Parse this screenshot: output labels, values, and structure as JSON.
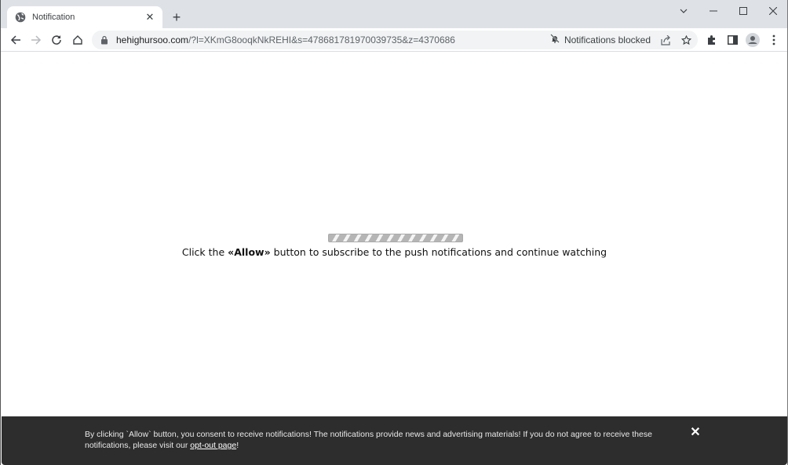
{
  "browser": {
    "tab": {
      "title": "Notification",
      "icon": "globe-icon",
      "close_icon": "close-icon"
    },
    "new_tab_icon": "plus-icon",
    "window_controls": [
      "tab-search-icon",
      "minimize-icon",
      "maximize-icon",
      "close-window-icon"
    ],
    "nav": [
      "back-icon",
      "forward-icon",
      "reload-icon",
      "home-icon"
    ],
    "omnibox": {
      "lock_icon": "lock-icon",
      "url_host": "hehighursoo.com",
      "url_rest": "/?l=XKmG8ooqkNkREHI&s=478681781970039735&z=4370686",
      "notifications_blocked": "Notifications blocked",
      "bell_icon": "bell-off-icon",
      "share_icon": "share-icon",
      "star_icon": "star-icon"
    },
    "toolbar_icons": [
      "extensions-icon",
      "side-panel-icon",
      "profile-icon",
      "menu-icon"
    ]
  },
  "page": {
    "message_pre": "Click the ",
    "message_bold": "«Allow»",
    "message_post": " button to subscribe to the push notifications and continue watching",
    "banner": {
      "text_line": "By clicking `Allow` button, you consent to receive notifications! The notifications provide news and advertising materials! If you do not agree to receive these notifications, please visit our ",
      "link": "opt-out page",
      "text_end": "!",
      "close_symbol": "✕"
    }
  },
  "colors": {
    "tabstrip": "#dee1e6",
    "omnibox": "#f1f3f4",
    "banner": "#2d2d2d"
  }
}
